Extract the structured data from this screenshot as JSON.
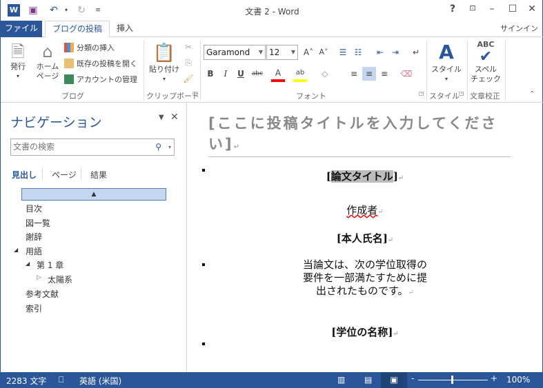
{
  "window": {
    "title": "文書 2 - Word",
    "help": "?",
    "signin": "サインイン"
  },
  "tabs": [
    {
      "label": "ファイル"
    },
    {
      "label": "ブログの投稿"
    },
    {
      "label": "挿入"
    }
  ],
  "ribbon": {
    "blog": {
      "label": "ブログ",
      "publish": "発行",
      "home1": "ホーム",
      "home2": "ページ",
      "insert_category": "分類の挿入",
      "open_existing": "既存の投稿を開く",
      "manage_accounts": "アカウントの管理"
    },
    "clipboard": {
      "label": "クリップボード",
      "paste": "貼り付け"
    },
    "font": {
      "label": "フォント",
      "font_name": "Garamond",
      "font_size": "12",
      "bold": "B",
      "italic": "I",
      "underline": "U",
      "strike": "abc",
      "font_color": "#ff0000",
      "highlight_color": "#ffff00"
    },
    "styles": {
      "label": "スタイル",
      "button": "スタイル"
    },
    "proofing": {
      "label": "文章校正",
      "spell1": "スペル",
      "spell2": "チェック",
      "abc": "ABC"
    }
  },
  "nav": {
    "title": "ナビゲーション",
    "search_placeholder": "文書の検索",
    "tabs": [
      "見出し",
      "ページ",
      "結果"
    ],
    "headings": [
      {
        "label": "目次",
        "level": 1
      },
      {
        "label": "図一覧",
        "level": 1
      },
      {
        "label": "謝辞",
        "level": 1
      },
      {
        "label": "用語",
        "level": 1,
        "expanded": true
      },
      {
        "label": "第 1 章",
        "level": 2,
        "expanded": true
      },
      {
        "label": "太陽系",
        "level": 3,
        "expanded": false
      },
      {
        "label": "参考文献",
        "level": 1
      },
      {
        "label": "索引",
        "level": 1
      }
    ]
  },
  "document": {
    "post_title": "[ここに投稿タイトルを入力してください]",
    "thesis_title": "論文タイトル",
    "author_label": "作成者",
    "author_name": "本人氏名",
    "statement": [
      "当論文は、次の学位取得の",
      "要件を一部満たすために提",
      "出されたものです。"
    ],
    "degree": "学位の名称"
  },
  "status": {
    "word_count": "2283 文字",
    "language": "英語 (米国)",
    "zoom": "100%",
    "zoom_percent": 100
  }
}
